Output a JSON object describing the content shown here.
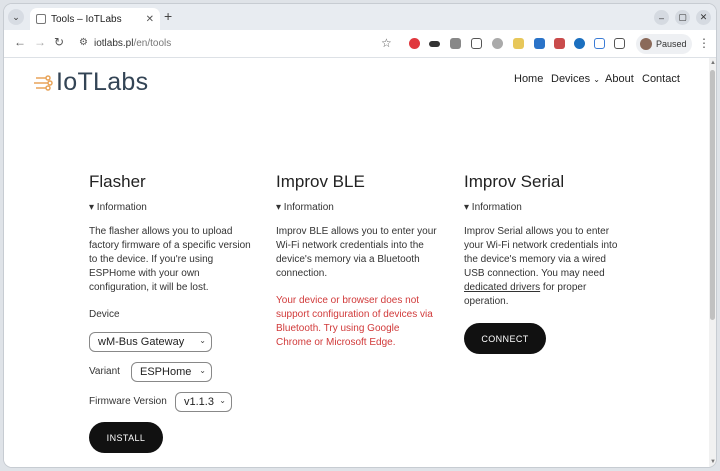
{
  "browser": {
    "tab_title": "Tools – IoTLabs",
    "url_domain": "iotlabs.pl",
    "url_path": "/en/tools",
    "profile_label": "Paused"
  },
  "site": {
    "logo_text": "IoTLabs",
    "nav": {
      "home": "Home",
      "devices": "Devices",
      "about": "About",
      "contact": "Contact"
    }
  },
  "flasher": {
    "title": "Flasher",
    "info_label": "▾ Information",
    "description": "The flasher allows you to upload factory firmware of a specific version to the device. If you're using ESPHome with your own configuration, it will be lost.",
    "device_label": "Device",
    "device_value": "wM-Bus Gateway",
    "variant_label": "Variant",
    "variant_value": "ESPHome",
    "firmware_label": "Firmware Version",
    "firmware_value": "v1.1.3",
    "install_label": "INSTALL"
  },
  "improv_ble": {
    "title": "Improv BLE",
    "info_label": "▾ Information",
    "description": "Improv BLE allows you to enter your Wi-Fi network credentials into the device's memory via a Bluetooth connection.",
    "warning": "Your device or browser does not support configuration of devices via Bluetooth. Try using Google Chrome or Microsoft Edge."
  },
  "improv_serial": {
    "title": "Improv Serial",
    "info_label": "▾ Information",
    "description_before": "Improv Serial allows you to enter your Wi-Fi network credentials into the device's memory via a wired USB connection. You may need ",
    "drivers_link": "dedicated drivers",
    "description_after": " for proper operation.",
    "connect_label": "CONNECT"
  },
  "colors": {
    "accent": "#111111",
    "warning": "#d13a3a",
    "logo": "#334455",
    "logo_icon": "#e8a45a"
  }
}
